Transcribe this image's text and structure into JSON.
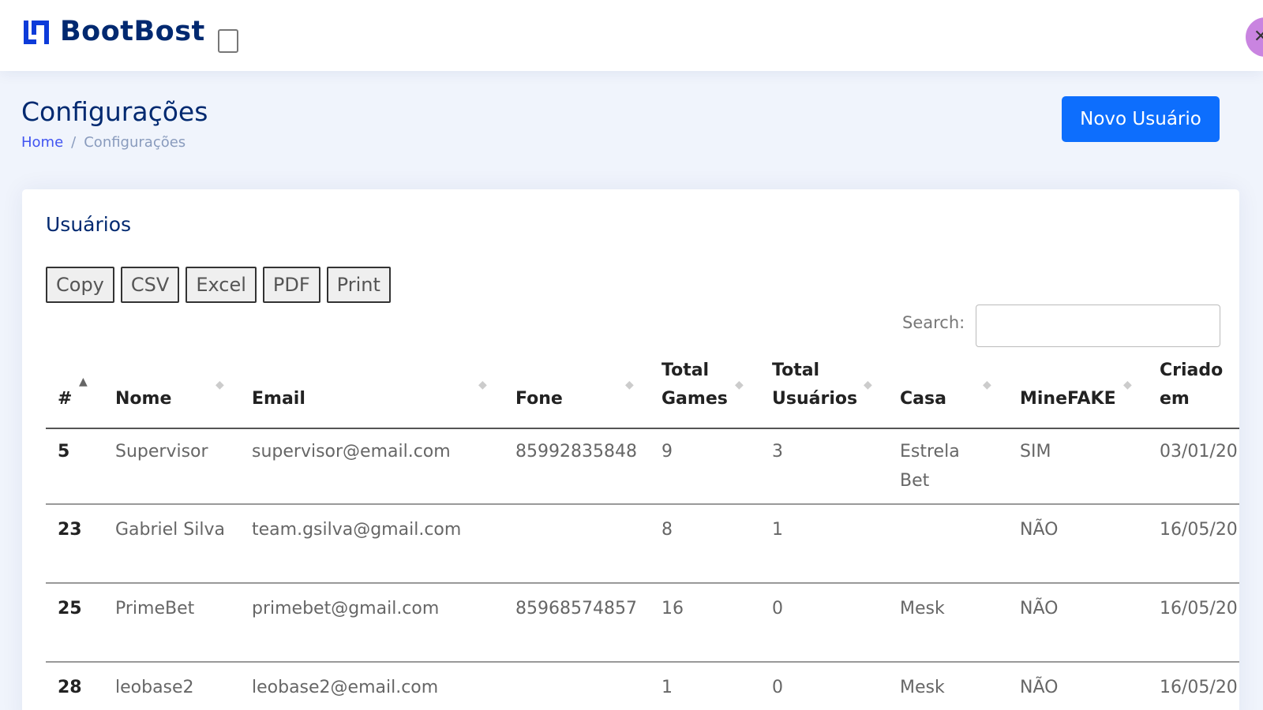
{
  "brand": {
    "name": "BootBost"
  },
  "page": {
    "title": "Configurações"
  },
  "breadcrumb": {
    "items": [
      "Home",
      "Configurações"
    ],
    "separator": "/"
  },
  "actions": {
    "new_user": "Novo Usuário"
  },
  "card": {
    "title": "Usuários"
  },
  "export": {
    "buttons": [
      "Copy",
      "CSV",
      "Excel",
      "PDF",
      "Print"
    ]
  },
  "search": {
    "label": "Search:",
    "value": ""
  },
  "table": {
    "headers": {
      "id": "#",
      "nome": "Nome",
      "email": "Email",
      "fone": "Fone",
      "total_games_1": "Total",
      "total_games_2": "Games",
      "total_usuarios_1": "Total",
      "total_usuarios_2": "Usuários",
      "casa": "Casa",
      "minefake": "MineFAKE",
      "criado_1": "Criado",
      "criado_2": "em"
    },
    "rows": [
      {
        "id": "5",
        "nome": "Supervisor",
        "email": "supervisor@email.com",
        "fone": "85992835848",
        "games": "9",
        "usuarios": "3",
        "casa_1": "Estrela",
        "casa_2": "Bet",
        "minefake": "SIM",
        "criado": "03/01/20"
      },
      {
        "id": "23",
        "nome": "Gabriel Silva",
        "email": "team.gsilva@gmail.com",
        "fone": "",
        "games": "8",
        "usuarios": "1",
        "casa_1": "",
        "casa_2": "",
        "minefake": "NÃO",
        "criado": "16/05/20"
      },
      {
        "id": "25",
        "nome": "PrimeBet",
        "email": "primebet@gmail.com",
        "fone": "85968574857",
        "games": "16",
        "usuarios": "0",
        "casa_1": "Mesk",
        "casa_2": "",
        "minefake": "NÃO",
        "criado": "16/05/20"
      },
      {
        "id": "28",
        "nome": "leobase2",
        "email": "leobase2@email.com",
        "fone": "",
        "games": "1",
        "usuarios": "0",
        "casa_1": "Mesk",
        "casa_2": "",
        "minefake": "NÃO",
        "criado": "16/05/20"
      }
    ]
  },
  "colors": {
    "brand": "#012970",
    "primary_button": "#0d6efd",
    "background": "#f0f4fc",
    "avatar": "#c984e0"
  }
}
